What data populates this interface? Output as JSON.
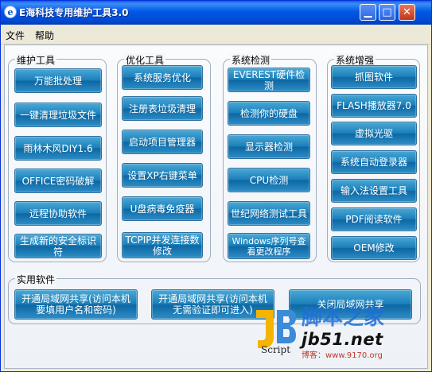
{
  "window": {
    "title": "E海科技专用维护工具3.0",
    "icon_letter": "e",
    "controls": {
      "minimize": "▁",
      "maximize": "□",
      "close": "✕"
    }
  },
  "menu": [
    "文件",
    "帮助"
  ],
  "groups": {
    "maintenance": {
      "title": "维护工具",
      "buttons": [
        "万能批处理",
        "一键清理垃圾文件",
        "雨林木风DIY1.6",
        "OFFICE密码破解",
        "远程协助软件",
        "生成新的安全标识符"
      ]
    },
    "optimize": {
      "title": "优化工具",
      "buttons": [
        "系统服务优化",
        "注册表垃圾清理",
        "启动项目管理器",
        "设置XP右键菜单",
        "U盘病毒免疫器",
        "TCPIP并发连接数修改"
      ]
    },
    "detect": {
      "title": "系统检测",
      "buttons": [
        "EVEREST硬件检测",
        "检测你的硬盘",
        "显示器检测",
        "CPU检测",
        "世纪网络测试工具",
        "Windows序列号查看更改程序"
      ]
    },
    "enhance": {
      "title": "系统增强",
      "buttons": [
        "抓图软件",
        "FLASH播放器7.0",
        "虚拟光驱",
        "系统自动登录器",
        "输入法设置工具",
        "PDF阅读软件",
        "OEM修改"
      ]
    },
    "utility": {
      "title": "实用软件",
      "buttons": [
        "开通局域网共享(访问本机要填用户名和密码)",
        "开通局域网共享(访问本机无需验证即可进入)",
        "关闭局域网共享"
      ]
    }
  },
  "watermark": {
    "logo_text": "JB",
    "site_name": "脚本之家",
    "url": "jb51.net",
    "script_label": "Script",
    "bottom_text": "博客：www.9170.org"
  },
  "colors": {
    "title_bar": "#0054e3",
    "button": "#1b7fb9",
    "watermark_blue": "#1f6fd6"
  }
}
